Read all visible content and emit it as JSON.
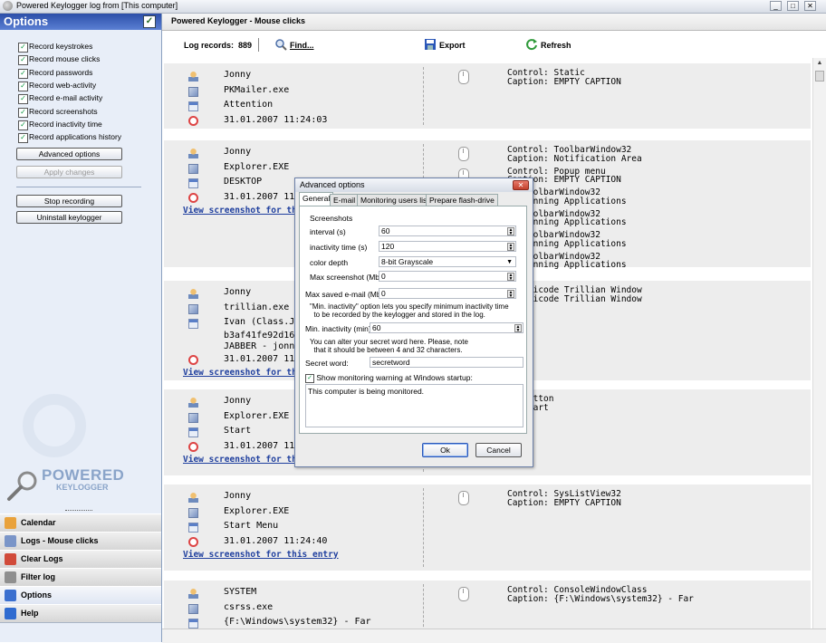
{
  "window": {
    "title": "Powered Keylogger log from [This computer]"
  },
  "left": {
    "header": "Options",
    "checkboxes": [
      {
        "label": "Record keystrokes",
        "checked": true
      },
      {
        "label": "Record mouse clicks",
        "checked": true
      },
      {
        "label": "Record passwords",
        "checked": true
      },
      {
        "label": "Record web-activity",
        "checked": true
      },
      {
        "label": "Record e-mail activity",
        "checked": true
      },
      {
        "label": "Record screenshots",
        "checked": true
      },
      {
        "label": "Record inactivity time",
        "checked": true
      },
      {
        "label": "Record applications history",
        "checked": true
      }
    ],
    "advanced_button": "Advanced options",
    "apply_button": "Apply changes",
    "stop_button": "Stop recording",
    "uninstall_button": "Uninstall keylogger",
    "logo": {
      "brand": "POWERED",
      "sub": "KEYLOGGER"
    },
    "nav": [
      {
        "label": "Calendar",
        "icon": "calendar-icon"
      },
      {
        "label": "Logs - Mouse clicks",
        "icon": "document-icon"
      },
      {
        "label": "Clear Logs",
        "icon": "clear-logs-icon"
      },
      {
        "label": "Filter log",
        "icon": "filter-icon"
      },
      {
        "label": "Options",
        "icon": "checkmark-icon"
      },
      {
        "label": "Help",
        "icon": "help-icon"
      }
    ]
  },
  "right": {
    "header": "Powered Keylogger - Mouse clicks",
    "toolbar": {
      "records_label": "Log records:",
      "records_count": "889",
      "find": "Find...",
      "export": "Export",
      "refresh": "Refresh"
    },
    "entries": [
      {
        "user": "Jonny",
        "app": "PKMailer.exe",
        "window": "Attention",
        "time": "31.01.2007 11:24:03",
        "link": "",
        "clicks": [
          {
            "control": "Control: Static",
            "caption": "Caption: EMPTY CAPTION"
          }
        ]
      },
      {
        "user": "Jonny",
        "app": "Explorer.EXE",
        "window": "DESKTOP",
        "time": "31.01.2007 11:24:",
        "link": "View screenshot for this en",
        "clicks": [
          {
            "control": "Control: ToolbarWindow32",
            "caption": "Caption: Notification Area"
          },
          {
            "control": "Control: Popup menu",
            "caption": "Caption: EMPTY CAPTION"
          },
          {
            "control": "l: ToolbarWindow32",
            "caption": "n: Running Applications"
          },
          {
            "control": "l: ToolbarWindow32",
            "caption": "n: Running Applications"
          },
          {
            "control": "l: ToolbarWindow32",
            "caption": "n: Running Applications"
          },
          {
            "control": "l: ToolbarWindow32",
            "caption": "n: Running Applications"
          }
        ]
      },
      {
        "user": "Jonny",
        "app": "trillian.exe",
        "window": "Ivan (Class.Jabb",
        "window2": "b3af41fe92d1664",
        "window3": "JABBER - jonny@",
        "time": "31.01.2007 11:2",
        "link": "View screenshot for this en",
        "clicks": [
          {
            "control": "l: Unicode Trillian Window",
            "caption": "n: Unicode Trillian Window"
          }
        ]
      },
      {
        "user": "Jonny",
        "app": "Explorer.EXE",
        "window": "Start",
        "time": "31.01.2007 11:2",
        "link": "View screenshot for this en",
        "clicks": [
          {
            "control": "l: Button",
            "caption": "n: Start"
          }
        ]
      },
      {
        "user": "Jonny",
        "app": "Explorer.EXE",
        "window": "Start Menu",
        "time": "31.01.2007 11:24:40",
        "link": "View screenshot for this entry",
        "clicks": [
          {
            "control": "Control: SysListView32",
            "caption": "Caption: EMPTY CAPTION"
          }
        ]
      },
      {
        "user": "SYSTEM",
        "app": "csrss.exe",
        "window": "{F:\\Windows\\system32} - Far",
        "time": "",
        "link": "",
        "clicks": [
          {
            "control": "Control: ConsoleWindowClass",
            "caption": "Caption: {F:\\Windows\\system32} - Far"
          }
        ]
      }
    ]
  },
  "dialog": {
    "title": "Advanced options",
    "tabs": [
      "General",
      "E-mail",
      "Monitoring users list",
      "Prepare flash-drive"
    ],
    "screenshots_group": "Screenshots",
    "interval_label": "interval (s)",
    "interval_value": "60",
    "inactivity_label": "inactivity time (s)",
    "inactivity_value": "120",
    "color_label": "color depth",
    "color_value": "8-bit Grayscale",
    "maxshot_label": "Max screenshot (Mb)",
    "maxshot_value": "0",
    "maxmail_label": "Max saved e-mail (Mb)",
    "maxmail_value": "0",
    "note1": "\"Min. inactivity\" option lets you specify minimum inactivity time\n  to be recorded by the keylogger and stored in the log.",
    "mininact_label": "Min. inactivity (min):",
    "mininact_value": "60",
    "note2": "You can alter your secret word here. Please, note\n  that it should be between 4 and 32 characters.",
    "secret_label": "Secret word:",
    "secret_value": "secretword",
    "warning_label": "Show monitoring warning at Windows startup:",
    "warning_checked": true,
    "warning_text": "This computer is being monitored.",
    "ok": "Ok",
    "cancel": "Cancel"
  }
}
